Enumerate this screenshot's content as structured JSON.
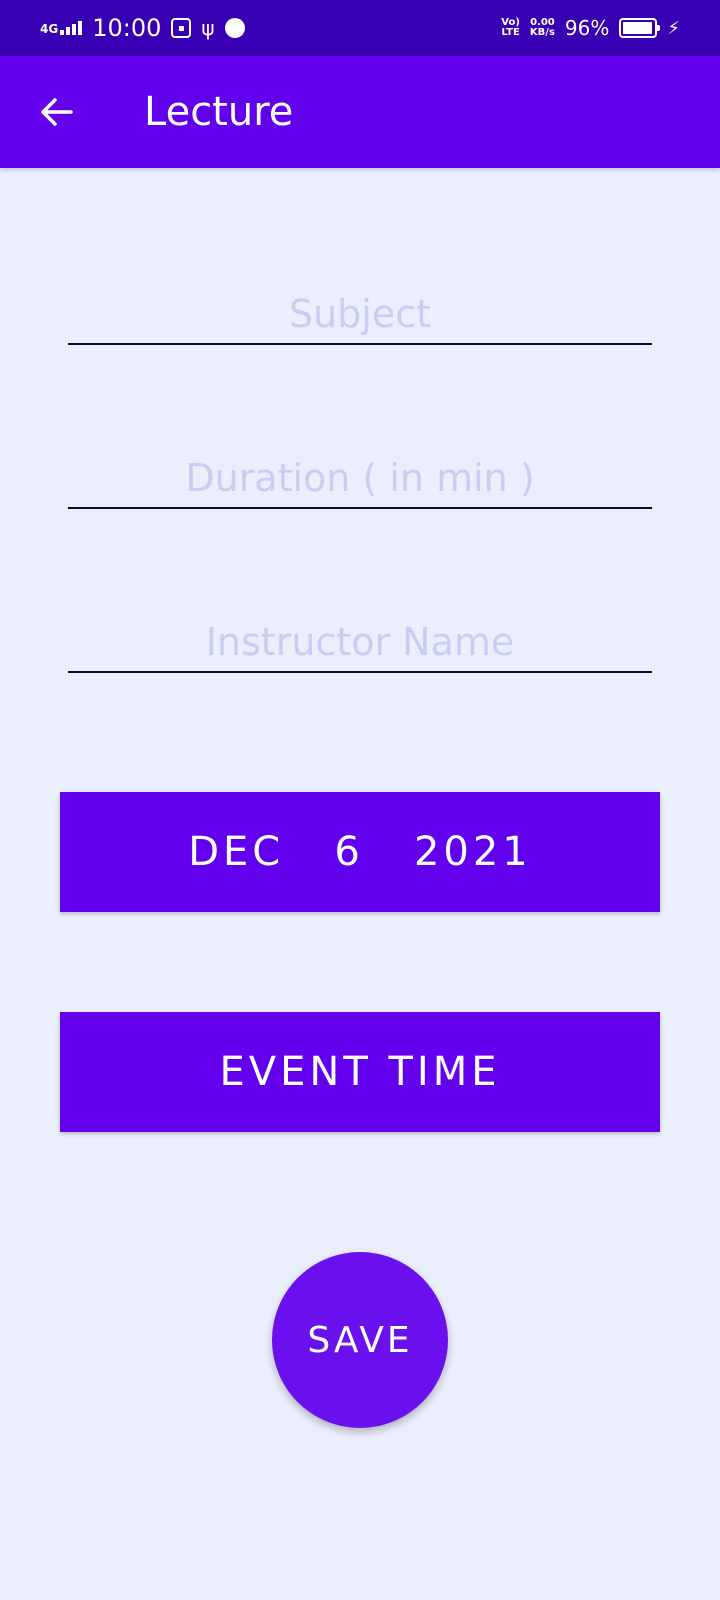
{
  "status_bar": {
    "network": "4G",
    "time": "10:00",
    "volte_top": "Vo)",
    "volte_bottom": "LTE",
    "speed_top": "0.00",
    "speed_bottom": "KB/s",
    "battery": "96%",
    "battery_level": 0.96
  },
  "app_bar": {
    "title": "Lecture",
    "back_icon": "arrow-back-icon"
  },
  "form": {
    "subject_placeholder": "Subject",
    "duration_placeholder": "Duration ( in min )",
    "instructor_placeholder": "Instructor Name",
    "date_button": "DEC   6   2021",
    "time_button": "EVENT TIME",
    "save_button": "SAVE"
  },
  "colors": {
    "status_bar": "#3700B3",
    "primary": "#6200EE",
    "background": "#EBEEFD",
    "placeholder": "#C9CDF3"
  }
}
